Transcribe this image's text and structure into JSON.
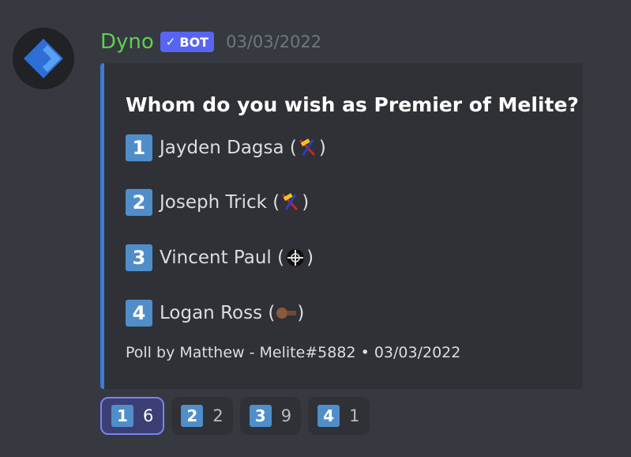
{
  "message": {
    "author": {
      "name": "Dyno",
      "bot_tag": "BOT",
      "avatar_icon": "dyno-logo-icon",
      "name_color": "#5fd04e"
    },
    "timestamp": "03/03/2022",
    "embed": {
      "accent_color": "#3d7ad6",
      "title": "Whom do you wish as Premier of Melite?",
      "options": [
        {
          "number": "1",
          "name": "Jayden Dagsa (",
          "close": ")",
          "party_icon": "hammer-party-icon"
        },
        {
          "number": "2",
          "name": "Joseph Trick (",
          "close": ")",
          "party_icon": "hammer-party-icon"
        },
        {
          "number": "3",
          "name": "Vincent Paul (",
          "close": ")",
          "party_icon": "crosshair-party-icon"
        },
        {
          "number": "4",
          "name": "Logan Ross (",
          "close": ")",
          "party_icon": "brown-party-icon"
        }
      ],
      "footer": "Poll by Matthew - Melite#5882 • 03/03/2022"
    },
    "reactions": [
      {
        "emoji": "1",
        "count": "6",
        "active": true
      },
      {
        "emoji": "2",
        "count": "2",
        "active": false
      },
      {
        "emoji": "3",
        "count": "9",
        "active": false
      },
      {
        "emoji": "4",
        "count": "1",
        "active": false
      }
    ]
  }
}
